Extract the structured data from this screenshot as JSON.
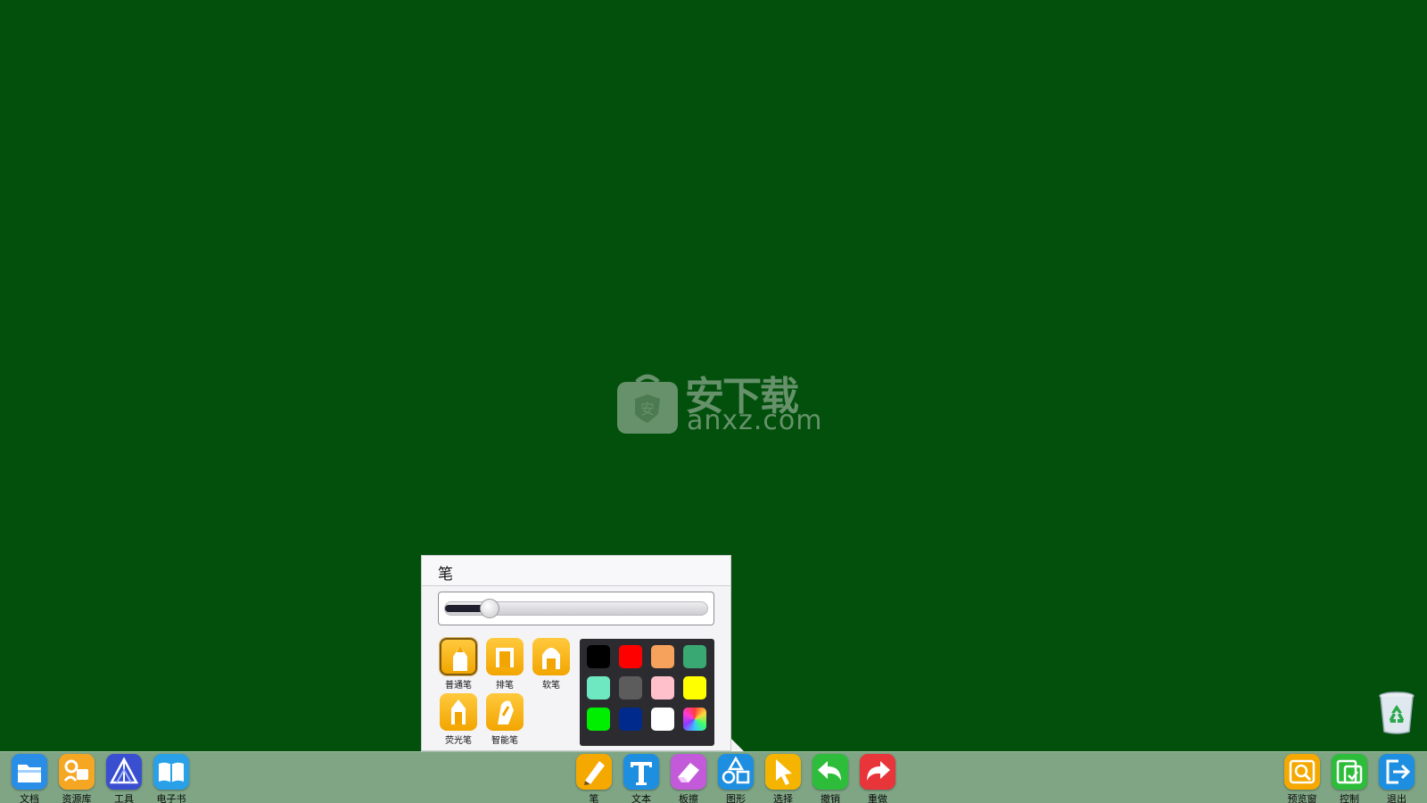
{
  "watermark": {
    "brand_cn": "安下载",
    "brand_en": "anxz.com",
    "badge_char": "安"
  },
  "pen_panel": {
    "title": "笔",
    "thickness_level": 0.17,
    "pen_types": [
      {
        "label": "普通笔",
        "selected": true
      },
      {
        "label": "排笔",
        "selected": false
      },
      {
        "label": "软笔",
        "selected": false
      },
      {
        "label": "荧光笔",
        "selected": false
      },
      {
        "label": "智能笔",
        "selected": false
      }
    ],
    "colors": [
      "#000000",
      "#ff0000",
      "#f6a25c",
      "#3aa872",
      "#6ee8c0",
      "#5c5c5c",
      "#ffc0cb",
      "#ffff00",
      "#00ee00",
      "#002a8c",
      "#ffffff",
      "rainbow"
    ]
  },
  "toolbar": {
    "left": [
      {
        "label": "文档",
        "icon": "folder-icon",
        "color": "#2a8ee8"
      },
      {
        "label": "资源库",
        "icon": "resource-library-icon",
        "color": "#f5a623"
      },
      {
        "label": "工具",
        "icon": "geometry-tools-icon",
        "color": "#3a4fd0"
      },
      {
        "label": "电子书",
        "icon": "book-icon",
        "color": "#2aa0e8"
      }
    ],
    "center": [
      {
        "label": "笔",
        "icon": "pen-icon",
        "color": "#f5a800"
      },
      {
        "label": "文本",
        "icon": "text-icon",
        "color": "#1e8fe0"
      },
      {
        "label": "板擦",
        "icon": "eraser-icon",
        "color": "#c35ad9"
      },
      {
        "label": "图形",
        "icon": "shapes-icon",
        "color": "#1e8fe0"
      },
      {
        "label": "选择",
        "icon": "cursor-icon",
        "color": "#f5b400"
      },
      {
        "label": "撤销",
        "icon": "undo-icon",
        "color": "#2dbd3a"
      },
      {
        "label": "重做",
        "icon": "redo-icon",
        "color": "#e8353a"
      }
    ],
    "right": [
      {
        "label": "预览窗",
        "icon": "preview-icon",
        "color": "#f5a800"
      },
      {
        "label": "控制",
        "icon": "control-icon",
        "color": "#2dbd3a"
      },
      {
        "label": "退出",
        "icon": "exit-icon",
        "color": "#1e8fe0"
      }
    ]
  }
}
